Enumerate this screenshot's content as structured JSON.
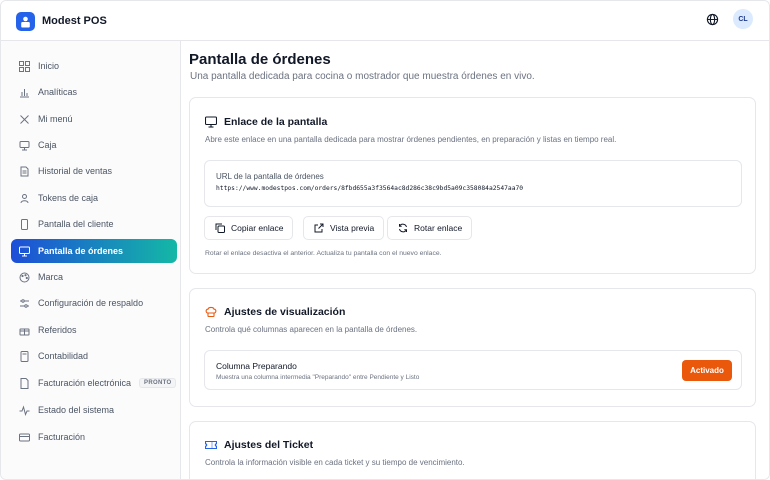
{
  "app": {
    "title": "Modest POS"
  },
  "header": {
    "avatar_initials": "CL",
    "language_icon": "globe-icon"
  },
  "sidebar": {
    "items": [
      {
        "label": "Inicio",
        "icon": "grid-icon"
      },
      {
        "label": "Analíticas",
        "icon": "bar-chart-icon"
      },
      {
        "label": "Mi menú",
        "icon": "utensils-icon"
      },
      {
        "label": "Caja",
        "icon": "register-icon"
      },
      {
        "label": "Historial de ventas",
        "icon": "history-icon"
      },
      {
        "label": "Tokens de caja",
        "icon": "token-icon"
      },
      {
        "label": "Pantalla del cliente",
        "icon": "tablet-icon"
      },
      {
        "label": "Pantalla de órdenes",
        "icon": "monitor-icon",
        "active": true
      },
      {
        "label": "Marca",
        "icon": "palette-icon"
      },
      {
        "label": "Configuración de respaldo",
        "icon": "sliders-icon"
      },
      {
        "label": "Referidos",
        "icon": "gift-icon"
      },
      {
        "label": "Contabilidad",
        "icon": "calculator-icon"
      },
      {
        "label": "Facturación electrónica",
        "icon": "file-icon",
        "badge": "PRONTO"
      },
      {
        "label": "Estado del sistema",
        "icon": "activity-icon"
      },
      {
        "label": "Facturación",
        "icon": "credit-card-icon"
      }
    ]
  },
  "main": {
    "title": "Pantalla de órdenes",
    "subtitle": "Una pantalla dedicada para cocina o mostrador que muestra órdenes en vivo.",
    "link_card": {
      "title": "Enlace de la pantalla",
      "description": "Abre este enlace en una pantalla dedicada para mostrar órdenes pendientes, en preparación y listas en tiempo real.",
      "url_label": "URL de la pantalla de órdenes",
      "url_value": "https://www.modestpos.com/orders/8fbd655a3f3564ac8d286c38c9bd5a09c358084a2547aa70",
      "copy_label": "Copiar enlace",
      "preview_label": "Vista previa",
      "rotate_label": "Rotar enlace",
      "note": "Rotar el enlace desactiva el anterior. Actualiza tu pantalla con el nuevo enlace."
    },
    "display_card": {
      "title": "Ajustes de visualización",
      "description": "Controla qué columnas aparecen en la pantalla de órdenes.",
      "row_title": "Columna Preparando",
      "row_desc": "Muestra una columna intermedia \"Preparando\" entre Pendiente y Listo",
      "toggle_label": "Activado"
    },
    "ticket_card": {
      "title": "Ajustes del Ticket",
      "description": "Controla la información visible en cada ticket y su tiempo de vencimiento."
    }
  },
  "colors": {
    "accent": "#2563eb",
    "active_gradient_end": "#14b8a6",
    "toggle": "#ea580c"
  }
}
